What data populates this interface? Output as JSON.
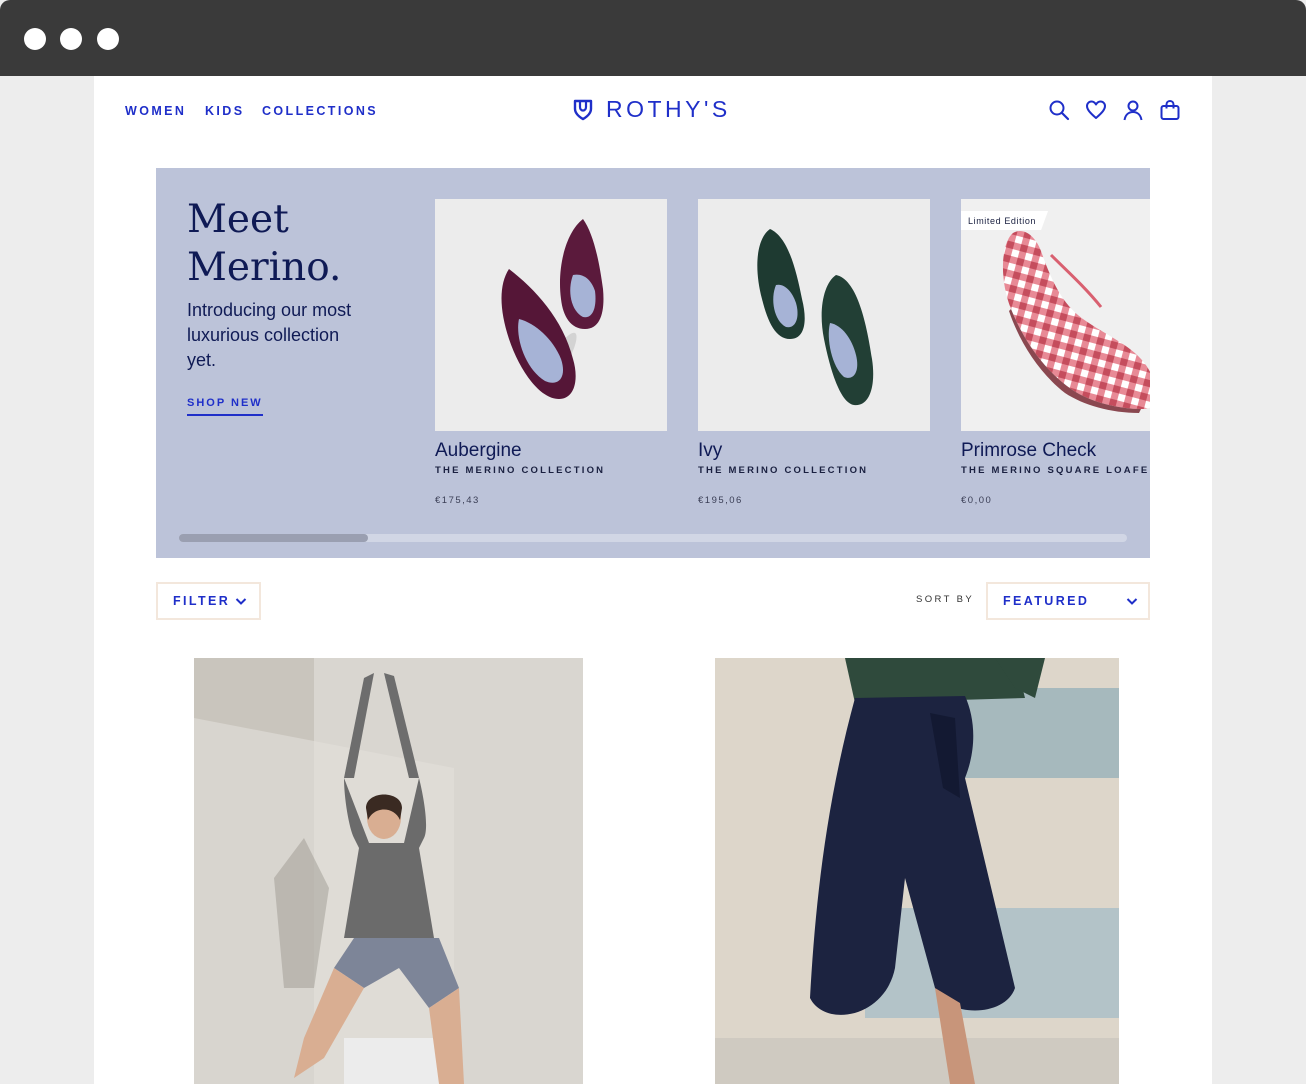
{
  "nav": {
    "women": "WOMEN",
    "kids": "KIDS",
    "collections": "COLLECTIONS"
  },
  "brand": {
    "name": "ROTHY'S",
    "color": "#1f2fc9"
  },
  "header_icons": [
    "search-icon",
    "heart-icon",
    "account-icon",
    "bag-icon"
  ],
  "hero": {
    "title_line1": "Meet",
    "title_line2": "Merino.",
    "subtitle": "Introducing our most luxurious collection yet.",
    "cta": "SHOP NEW",
    "background": "#bcc3d9",
    "scroll_position": 0.2
  },
  "products": [
    {
      "name": "Aubergine",
      "collection": "THE MERINO COLLECTION",
      "price": "€175,43",
      "color": "#5a1a3a"
    },
    {
      "name": "Ivy",
      "collection": "THE MERINO COLLECTION",
      "price": "€195,06",
      "color": "#1f3a32"
    },
    {
      "name": "Primrose Check",
      "collection": "THE MERINO SQUARE LOAFER",
      "price": "€0,00",
      "badge": "Limited Edition",
      "color": "#d96070"
    }
  ],
  "toolbar": {
    "filter": "FILTER",
    "sort_label": "SORT BY",
    "sort_value": "FEATURED"
  }
}
